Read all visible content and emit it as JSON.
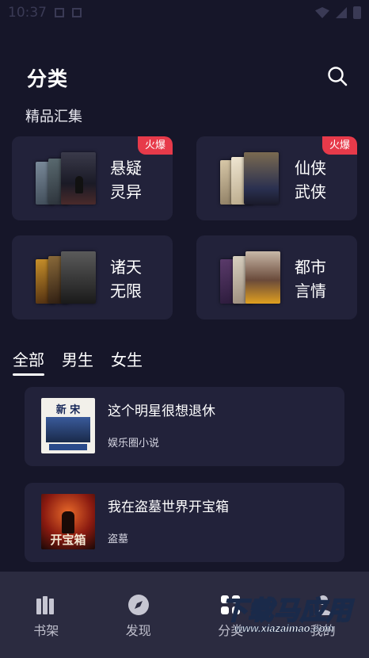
{
  "status_bar": {
    "time": "10:37"
  },
  "header": {
    "title": "分类"
  },
  "section": {
    "title": "精品汇集"
  },
  "categories": [
    {
      "line1": "悬疑",
      "line2": "灵异",
      "badge": "火爆"
    },
    {
      "line1": "仙侠",
      "line2": "武侠",
      "badge": "火爆"
    },
    {
      "line1": "诸天",
      "line2": "无限",
      "badge": ""
    },
    {
      "line1": "都市",
      "line2": "言情",
      "badge": ""
    }
  ],
  "tabs": [
    {
      "label": "全部",
      "active": true
    },
    {
      "label": "男生",
      "active": false
    },
    {
      "label": "女生",
      "active": false
    }
  ],
  "books": [
    {
      "title": "这个明星很想退休",
      "genre": "娱乐圈小说",
      "cover_text": "新 宋"
    },
    {
      "title": "我在盗墓世界开宝箱",
      "genre": "盗墓",
      "cover_text": "开宝箱"
    }
  ],
  "bottom_nav": [
    {
      "label": "书架",
      "icon": "bookshelf-icon"
    },
    {
      "label": "发现",
      "icon": "compass-icon"
    },
    {
      "label": "分类",
      "icon": "category-icon"
    },
    {
      "label": "我的",
      "icon": "user-icon"
    }
  ],
  "watermark": {
    "main": "下载马应用",
    "url": "www.xiazaimao.com"
  },
  "colors": {
    "background": "#161629",
    "card": "#22223a",
    "badge": "#e73a4a",
    "nav": "#2b2b40"
  }
}
